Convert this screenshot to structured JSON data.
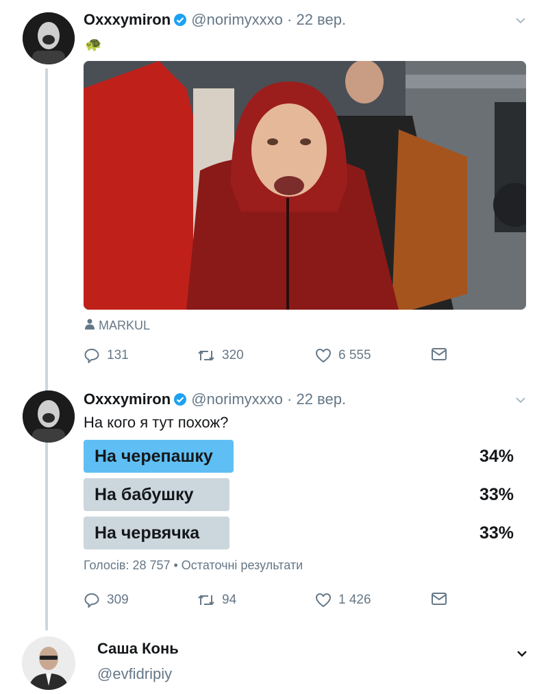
{
  "tweet1": {
    "name": "Oxxxymiron",
    "handle": "@norimyxxxo",
    "separator": "·",
    "date": "22 вер.",
    "emoji": "🐢",
    "photo_credit": "MARKUL",
    "replies": "131",
    "retweets": "320",
    "likes": "6 555"
  },
  "tweet2": {
    "name": "Oxxxymiron",
    "handle": "@norimyxxxo",
    "separator": "·",
    "date": "22 вер.",
    "text": "На кого я тут похож?",
    "poll": {
      "options": [
        {
          "label": "На черепашку",
          "percent": "34%",
          "value": 34,
          "winner": true
        },
        {
          "label": "На бабушку",
          "percent": "33%",
          "value": 33,
          "winner": false
        },
        {
          "label": "На червячка",
          "percent": "33%",
          "value": 33,
          "winner": false
        }
      ],
      "meta": "Голосів: 28 757 • Остаточні результати"
    },
    "replies": "309",
    "retweets": "94",
    "likes": "1 426"
  },
  "tweet3": {
    "name": "Саша Конь",
    "handle": "@evfidripiy"
  },
  "colors": {
    "accent": "#1da1f2",
    "poll_winner": "#5fbff4",
    "poll_other": "#ccd6dd",
    "secondary_text": "#657786"
  },
  "icons": [
    "verified-badge-icon",
    "chevron-down-icon",
    "person-icon",
    "reply-icon",
    "retweet-icon",
    "like-icon",
    "dm-icon"
  ]
}
